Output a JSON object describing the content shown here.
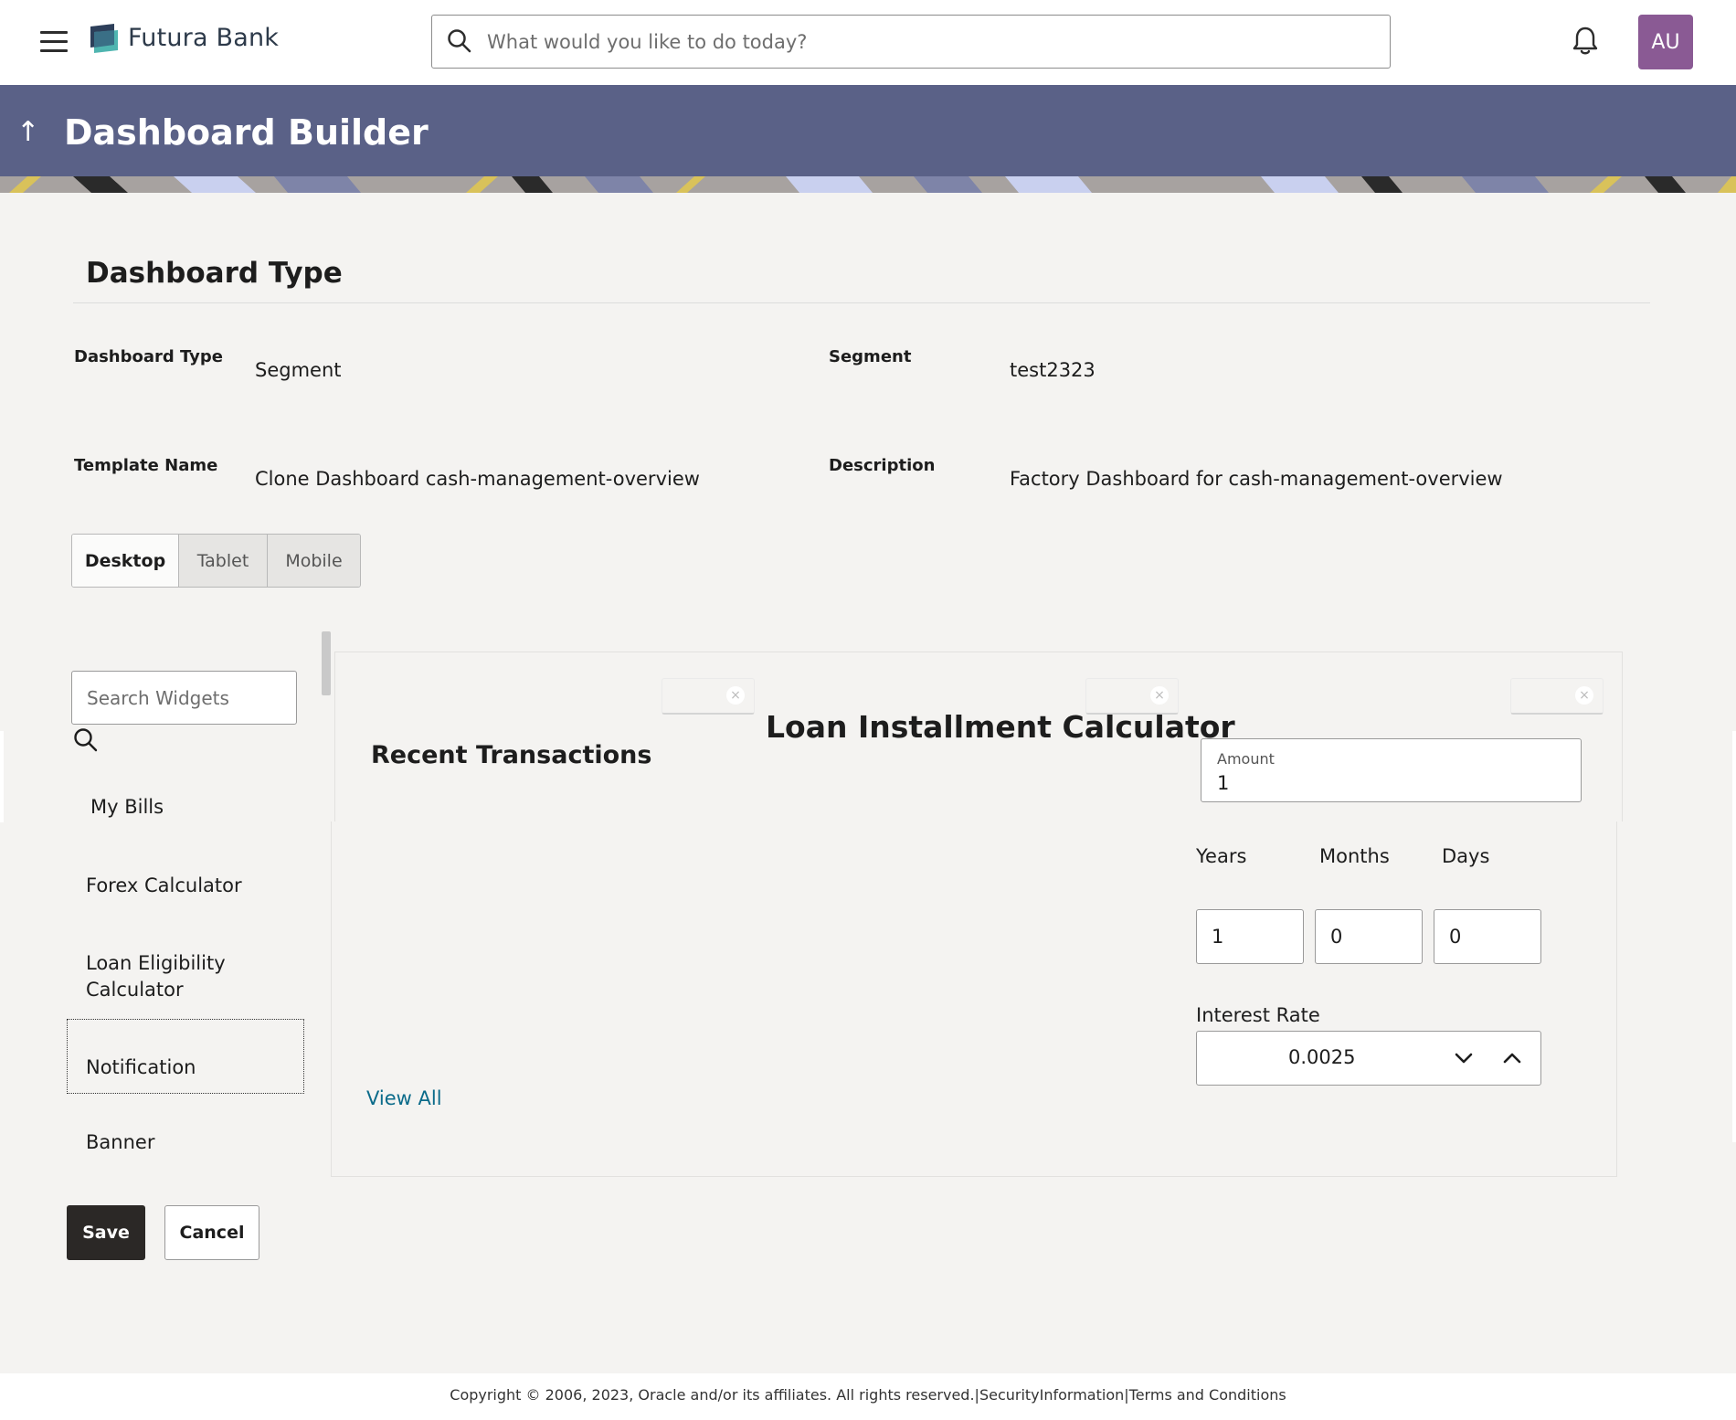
{
  "app": {
    "brand": "Futura Bank"
  },
  "topbar": {
    "search_placeholder": "What would you like to do today?",
    "avatar_initials": "AU"
  },
  "banner": {
    "title": "Dashboard Builder"
  },
  "dashboard_type": {
    "section_title": "Dashboard Type",
    "fields": {
      "dashboard_type": {
        "label": "Dashboard Type",
        "value": "Segment"
      },
      "segment": {
        "label": "Segment",
        "value": "test2323"
      },
      "template_name": {
        "label": "Template Name",
        "value": "Clone Dashboard cash-management-overview"
      },
      "description": {
        "label": "Description",
        "value": "Factory Dashboard for cash-management-overview"
      }
    }
  },
  "device_tabs": [
    "Desktop",
    "Tablet",
    "Mobile"
  ],
  "widgets": {
    "search_placeholder": "Search Widgets",
    "items": [
      "My Bills",
      "Forex Calculator",
      "Loan Eligibility Calculator",
      "Notification",
      "Banner"
    ]
  },
  "canvas": {
    "recent_transactions": {
      "title": "Recent Transactions",
      "view_all": "View All"
    },
    "loan_calculator": {
      "title": "Loan Installment Calculator",
      "amount_label": "Amount",
      "amount_value": "1",
      "years_label": "Years",
      "months_label": "Months",
      "days_label": "Days",
      "years_value": "1",
      "months_value": "0",
      "days_value": "0",
      "interest_label": "Interest Rate",
      "interest_value": "0.0025"
    },
    "chip_close_glyph": "×"
  },
  "actions": {
    "save": "Save",
    "cancel": "Cancel"
  },
  "footer": {
    "copyright": "Copyright © 2006, 2023, Oracle and/or its affiliates. All rights reserved.",
    "sep1": "|",
    "security": "SecurityInformation",
    "sep2": "|",
    "terms": "Terms and Conditions"
  },
  "colors": {
    "banner": "#5a6187",
    "primary_button": "#2b2826",
    "link": "#0b6b8a",
    "avatar": "#8a5a94"
  },
  "icons": [
    "hamburger-icon",
    "bank-logo-icon",
    "search-icon",
    "bell-icon",
    "back-arrow-icon",
    "chevron-down-icon",
    "chevron-up-icon",
    "close-icon"
  ]
}
